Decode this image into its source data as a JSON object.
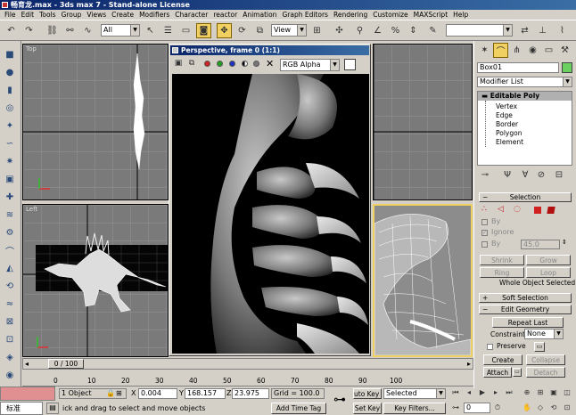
{
  "window": {
    "title": "畅育龙.max - 3ds max 7 - Stand-alone License"
  },
  "menu": [
    "File",
    "Edit",
    "Tools",
    "Group",
    "Views",
    "Create",
    "Modifiers",
    "Character",
    "reactor",
    "Animation",
    "Graph Editors",
    "Rendering",
    "Customize",
    "MAXScript",
    "Help"
  ],
  "toolbar": {
    "selection_filter": "All",
    "ref_coord": "View"
  },
  "viewports": {
    "top": "Top",
    "left": "Left",
    "right_partial": ""
  },
  "render_window": {
    "title": "Perspective, frame 0 (1:1)",
    "channel": "RGB Alpha",
    "close_glyph": "✕"
  },
  "command_panel": {
    "object_name": "Box01",
    "object_color": "#6ad060",
    "modifier_list": "Modifier List",
    "stack": {
      "base": "Editable Poly",
      "subobjects": [
        "Vertex",
        "Edge",
        "Border",
        "Polygon",
        "Element"
      ]
    },
    "selection": {
      "header": "Selection",
      "by": "By",
      "ignore": "Ignore",
      "by2": "By",
      "threshold": "45.0",
      "shrink": "Shrink",
      "grow": "Grow",
      "ring": "Ring",
      "loop": "Loop",
      "status": "Whole Object Selected"
    },
    "soft_selection": "Soft Selection",
    "edit_geometry": {
      "header": "Edit Geometry",
      "repeat_last": "Repeat Last",
      "constraints_label": "Constraints:",
      "constraints_value": "None",
      "preserve": "Preserve",
      "create": "Create",
      "collapse": "Collapse",
      "attach": "Attach",
      "detach": "Detach"
    }
  },
  "timeline": {
    "frame": "0 / 100",
    "ticks": [
      "0",
      "10",
      "20",
      "30",
      "40",
      "50",
      "60",
      "70",
      "80",
      "90",
      "100"
    ]
  },
  "status": {
    "objects": "1 Object",
    "x_label": "X",
    "x": "0.004",
    "y_label": "Y",
    "y": "168.157",
    "z_label": "Z",
    "z": "23.975",
    "grid": "Grid = 100.0",
    "prompt": "ick and drag to select and move objects",
    "add_time_tag": "Add Time Tag",
    "auto_key": "uto Key",
    "selected": "Selected",
    "set_key": "Set Key",
    "key_filters": "Key Filters...",
    "script_listener": "标准",
    "frame_field": "0"
  }
}
